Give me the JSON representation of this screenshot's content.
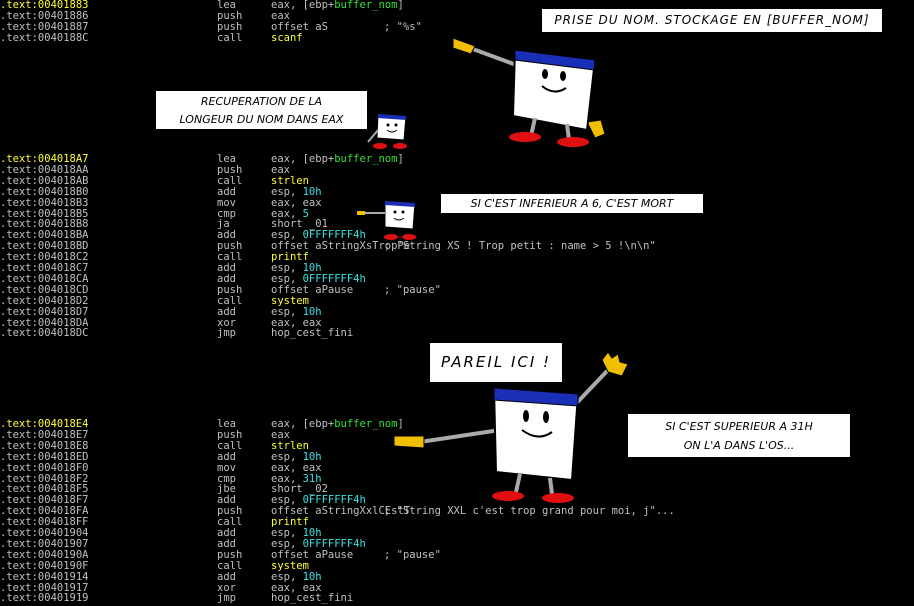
{
  "code_sections": [
    {
      "name": "scanf-block",
      "lines": [
        {
          "addr": ".text:00401883",
          "mn": "lea",
          "op": "eax, [ebp+buffer_nom]",
          "cm": "",
          "hl": true
        },
        {
          "addr": ".text:00401886",
          "mn": "push",
          "op": "eax",
          "cm": ""
        },
        {
          "addr": ".text:00401887",
          "mn": "push",
          "op": "offset aS",
          "cm": "; \"%s\""
        },
        {
          "addr": ".text:0040188C",
          "mn": "call",
          "op": "scanf",
          "cm": ""
        }
      ]
    },
    {
      "name": "strlen-block",
      "lines": [
        {
          "addr": ".text:004018A7",
          "mn": "lea",
          "op": "eax, [ebp+buffer_nom]",
          "cm": "",
          "hl": true
        },
        {
          "addr": ".text:004018AA",
          "mn": "push",
          "op": "eax",
          "cm": ""
        },
        {
          "addr": ".text:004018AB",
          "mn": "call",
          "op": "strlen",
          "cm": ""
        },
        {
          "addr": ".text:004018B0",
          "mn": "add",
          "op": "esp, 10h",
          "cm": ""
        },
        {
          "addr": ".text:004018B3",
          "mn": "mov",
          "op": "eax, eax",
          "cm": ""
        },
        {
          "addr": ".text:004018B5",
          "mn": "cmp",
          "op": "eax, 5",
          "cm": ""
        },
        {
          "addr": ".text:004018B8",
          "mn": "ja",
          "op": "short _01",
          "cm": ""
        },
        {
          "addr": ".text:004018BA",
          "mn": "add",
          "op": "esp, 0FFFFFFF4h",
          "cm": ""
        },
        {
          "addr": ".text:004018BD",
          "mn": "push",
          "op": "offset aStringXsTropPe",
          "cm": "; \"String XS ! Trop petit : name > 5 !\\n\\n\""
        },
        {
          "addr": ".text:004018C2",
          "mn": "call",
          "op": "printf",
          "cm": ""
        },
        {
          "addr": ".text:004018C7",
          "mn": "add",
          "op": "esp, 10h",
          "cm": ""
        },
        {
          "addr": ".text:004018CA",
          "mn": "add",
          "op": "esp, 0FFFFFFF4h",
          "cm": ""
        },
        {
          "addr": ".text:004018CD",
          "mn": "push",
          "op": "offset aPause",
          "cm": "; \"pause\""
        },
        {
          "addr": ".text:004018D2",
          "mn": "call",
          "op": "system",
          "cm": ""
        },
        {
          "addr": ".text:004018D7",
          "mn": "add",
          "op": "esp, 10h",
          "cm": ""
        },
        {
          "addr": ".text:004018DA",
          "mn": "xor",
          "op": "eax, eax",
          "cm": ""
        },
        {
          "addr": ".text:004018DC",
          "mn": "jmp",
          "op": "hop_cest_fini",
          "cm": ""
        }
      ]
    },
    {
      "name": "xxl-block",
      "lines": [
        {
          "addr": ".text:004018E4",
          "mn": "lea",
          "op": "eax, [ebp+buffer_nom]",
          "cm": "",
          "hl": true
        },
        {
          "addr": ".text:004018E7",
          "mn": "push",
          "op": "eax",
          "cm": ""
        },
        {
          "addr": ".text:004018E8",
          "mn": "call",
          "op": "strlen",
          "cm": ""
        },
        {
          "addr": ".text:004018ED",
          "mn": "add",
          "op": "esp, 10h",
          "cm": ""
        },
        {
          "addr": ".text:004018F0",
          "mn": "mov",
          "op": "eax, eax",
          "cm": ""
        },
        {
          "addr": ".text:004018F2",
          "mn": "cmp",
          "op": "eax, 31h",
          "cm": ""
        },
        {
          "addr": ".text:004018F5",
          "mn": "jbe",
          "op": "short _02",
          "cm": ""
        },
        {
          "addr": ".text:004018F7",
          "mn": "add",
          "op": "esp, 0FFFFFFF4h",
          "cm": ""
        },
        {
          "addr": ".text:004018FA",
          "mn": "push",
          "op": "offset aStringXxlCEstT",
          "cm": "; \"String XXL c'est trop grand pour moi, j\"..."
        },
        {
          "addr": ".text:004018FF",
          "mn": "call",
          "op": "printf",
          "cm": ""
        },
        {
          "addr": ".text:00401904",
          "mn": "add",
          "op": "esp, 10h",
          "cm": ""
        },
        {
          "addr": ".text:00401907",
          "mn": "add",
          "op": "esp, 0FFFFFFF4h",
          "cm": ""
        },
        {
          "addr": ".text:0040190A",
          "mn": "push",
          "op": "offset aPause",
          "cm": "; \"pause\""
        },
        {
          "addr": ".text:0040190F",
          "mn": "call",
          "op": "system",
          "cm": ""
        },
        {
          "addr": ".text:00401914",
          "mn": "add",
          "op": "esp, 10h",
          "cm": ""
        },
        {
          "addr": ".text:00401917",
          "mn": "xor",
          "op": "eax, eax",
          "cm": ""
        },
        {
          "addr": ".text:00401919",
          "mn": "jmp",
          "op": "hop_cest_fini",
          "cm": ""
        }
      ]
    }
  ],
  "bubbles": {
    "prise": "PRISE DU NOM. STOCKAGE EN [BUFFER_NOM]",
    "recup_line1": "RECUPERATION DE LA",
    "recup_line2": "LONGEUR DU NOM DANS EAX",
    "inferieur": "SI C'EST INFERIEUR A 6, C'EST MORT",
    "pareil": "PAREIL ICI !",
    "sup_line1": "SI C'EST SUPERIEUR A 31H",
    "sup_line2": "ON L'A DANS L'OS..."
  },
  "colors": {
    "background": "#000000",
    "text": "#c0c0c0",
    "address_highlight": "#ffff33",
    "number": "#3fe0e0",
    "variable": "#33e033",
    "character_band": "#1a2fb8",
    "shoes": "#e01010",
    "glove": "#f0c000"
  }
}
